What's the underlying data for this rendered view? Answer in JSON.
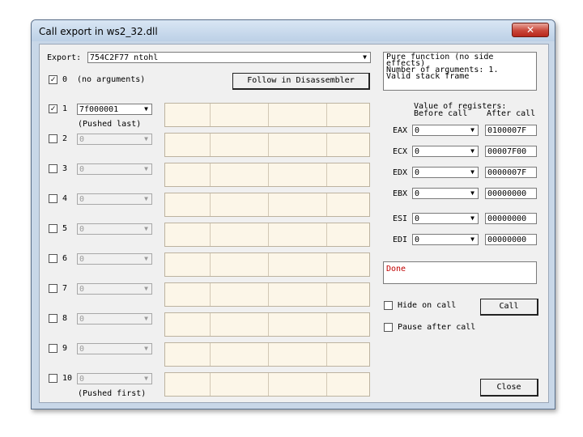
{
  "window": {
    "title": "Call export in ws2_32.dll",
    "close_glyph": "✕"
  },
  "export": {
    "label": "Export:",
    "value": "754C2F77  ntohl",
    "info_lines": [
      "Pure function (no side",
      "effects)",
      "Number of arguments: 1.",
      "Valid stack frame"
    ]
  },
  "args": {
    "zero": {
      "checked": true,
      "label": "0",
      "text": "(no arguments)"
    },
    "follow_button": "Follow in Disassembler",
    "rows": [
      {
        "num": "1",
        "checked": true,
        "value": "7f000001",
        "enabled": true,
        "note": "(Pushed last)"
      },
      {
        "num": "2",
        "checked": false,
        "value": "0",
        "enabled": false,
        "note": ""
      },
      {
        "num": "3",
        "checked": false,
        "value": "0",
        "enabled": false,
        "note": ""
      },
      {
        "num": "4",
        "checked": false,
        "value": "0",
        "enabled": false,
        "note": ""
      },
      {
        "num": "5",
        "checked": false,
        "value": "0",
        "enabled": false,
        "note": ""
      },
      {
        "num": "6",
        "checked": false,
        "value": "0",
        "enabled": false,
        "note": ""
      },
      {
        "num": "7",
        "checked": false,
        "value": "0",
        "enabled": false,
        "note": ""
      },
      {
        "num": "8",
        "checked": false,
        "value": "0",
        "enabled": false,
        "note": ""
      },
      {
        "num": "9",
        "checked": false,
        "value": "0",
        "enabled": false,
        "note": ""
      },
      {
        "num": "10",
        "checked": false,
        "value": "0",
        "enabled": false,
        "note": "(Pushed first)"
      }
    ]
  },
  "registers": {
    "header_1": "Value of registers:",
    "before_label": "Before call",
    "after_label": "After call",
    "rows": [
      {
        "name": "EAX",
        "before": "0",
        "after": "0100007F"
      },
      {
        "name": "ECX",
        "before": "0",
        "after": "00007F00"
      },
      {
        "name": "EDX",
        "before": "0",
        "after": "0000007F"
      },
      {
        "name": "EBX",
        "before": "0",
        "after": "00000000"
      },
      {
        "name": "ESI",
        "before": "0",
        "after": "00000000"
      },
      {
        "name": "EDI",
        "before": "0",
        "after": "00000000"
      }
    ]
  },
  "status": {
    "text": "Done",
    "color": "#c00000"
  },
  "options": {
    "hide_on_call": {
      "label": "Hide on call",
      "checked": false
    },
    "pause_after_call": {
      "label": "Pause after call",
      "checked": false
    }
  },
  "buttons": {
    "call": "Call",
    "close": "Close"
  },
  "icons": {
    "dropdown": "▼",
    "check": "✓"
  }
}
